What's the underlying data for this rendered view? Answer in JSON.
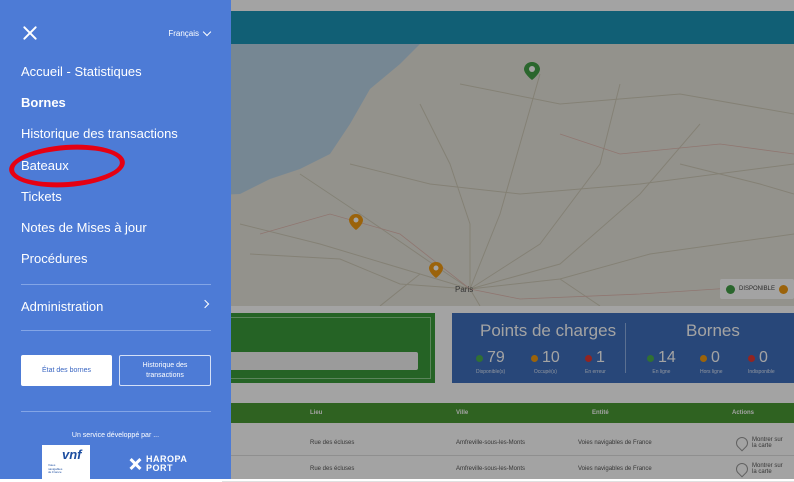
{
  "drawer": {
    "language": "Français",
    "menu": [
      {
        "label": "Accueil - Statistiques"
      },
      {
        "label": "Bornes"
      },
      {
        "label": "Historique des transactions"
      },
      {
        "label": "Bateaux"
      },
      {
        "label": "Tickets"
      },
      {
        "label": "Notes de Mises à jour"
      },
      {
        "label": "Procédures"
      }
    ],
    "administration": "Administration",
    "buttons": {
      "etat_bornes": "État des bornes",
      "historique_line1": "Historique des",
      "historique_line2": "transactions"
    },
    "service_text": "Un service développé par ...",
    "logos": {
      "vnf": "vnf",
      "vnf_sub_line1": "Voies",
      "vnf_sub_line2": "navigables",
      "vnf_sub_line3": "de France",
      "haropa_line1": "HAROPA",
      "haropa_line2": "PORT"
    }
  },
  "map": {
    "city_label": "Paris",
    "legend": {
      "label": "DISPONIBLE"
    }
  },
  "stats": {
    "points_title": "Points de charges",
    "bornes_title": "Bornes",
    "points": [
      {
        "value": "79",
        "label": "Disponible(s)",
        "color": "#4caf50"
      },
      {
        "value": "10",
        "label": "Occupé(s)",
        "color": "#f39c12"
      },
      {
        "value": "1",
        "label": "En erreur",
        "color": "#e53935"
      }
    ],
    "bornes": [
      {
        "value": "14",
        "label": "En ligne",
        "color": "#4caf50"
      },
      {
        "value": "0",
        "label": "Hors ligne",
        "color": "#f39c12"
      },
      {
        "value": "0",
        "label": "Indisponible",
        "color": "#e53935"
      }
    ]
  },
  "table": {
    "headers": {
      "lieu": "Lieu",
      "ville": "Ville",
      "entite": "Entité",
      "actions": "Actions"
    },
    "rows": [
      {
        "lieu": "Rue des écluses",
        "ville": "Amfreville-sous-les-Monts",
        "entite": "Voies navigables de France",
        "action_line1": "Montrer sur",
        "action_line2": "la carte"
      },
      {
        "lieu": "Rue des écluses",
        "ville": "Amfreville-sous-les-Monts",
        "entite": "Voies navigables de France",
        "action_line1": "Montrer sur",
        "action_line2": "la carte"
      }
    ]
  },
  "colors": {
    "drawer_bg": "#4d7bd6",
    "highlight": "#e60012",
    "topbar": "#1b95b8",
    "table_header": "#4a9a34",
    "stats_card": "#3f6fbd"
  }
}
